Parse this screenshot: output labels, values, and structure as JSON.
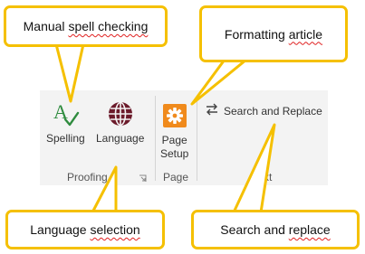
{
  "ribbon": {
    "buttons": {
      "spelling": {
        "label": "Spelling",
        "icon": "spell-check-icon"
      },
      "language": {
        "label": "Language",
        "icon": "globe-icon"
      },
      "page_setup": {
        "label": "Page\nSetup",
        "icon": "gear-icon"
      },
      "search_replace": {
        "label": "Search and Replace",
        "icon": "swap-arrows-icon"
      }
    },
    "groups": {
      "proofing": "Proofing",
      "page": "Page",
      "third_partial": "xt"
    }
  },
  "callouts": {
    "manual_spell": {
      "pre": "Manual ",
      "spell": "spell checking",
      "post": ""
    },
    "formatting": {
      "pre": "Formatting ",
      "spell": "article",
      "post": ""
    },
    "language": {
      "pre": "Language ",
      "spell": "selection",
      "post": ""
    },
    "search": {
      "pre": "Search and ",
      "spell": "replace",
      "post": ""
    }
  },
  "colors": {
    "callout_border": "#f5c000",
    "spell_check_green": "#2e8b3e",
    "globe_dark_red": "#6b1a2a",
    "page_setup_orange": "#f08a1c",
    "spell_underline": "#e02020"
  }
}
